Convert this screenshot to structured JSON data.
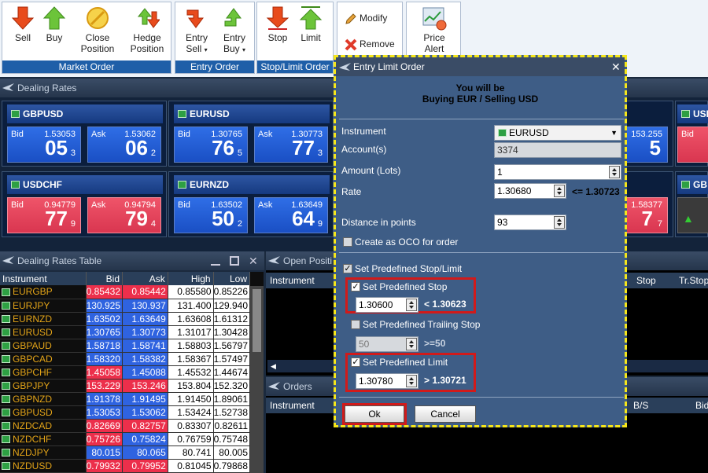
{
  "ribbon": {
    "market_order": {
      "label": "Market Order",
      "sell": "Sell",
      "buy": "Buy",
      "close1": "Close",
      "close2": "Position",
      "hedge1": "Hedge",
      "hedge2": "Position"
    },
    "entry_order": {
      "label": "Entry Order",
      "sell1": "Entry",
      "sell2": "Sell",
      "buy1": "Entry",
      "buy2": "Buy"
    },
    "stop_limit": {
      "label": "Stop/Limit Order",
      "stop": "Stop",
      "limit": "Limit"
    },
    "modify": "Modify",
    "remove": "Remove",
    "price_alert1": "Price",
    "price_alert2": "Alert"
  },
  "dealing_rates": {
    "title": "Dealing Rates",
    "tiles": [
      {
        "symbol": "GBPUSD",
        "bid_label": "Bid",
        "bid_price": "1.53053",
        "bid_big": "05",
        "bid_small": "3",
        "ask_label": "Ask",
        "ask_price": "1.53062",
        "ask_big": "06",
        "ask_small": "2"
      },
      {
        "symbol": "EURUSD",
        "bid_label": "Bid",
        "bid_price": "1.30765",
        "bid_big": "76",
        "bid_small": "5",
        "ask_label": "Ask",
        "ask_price": "1.30773",
        "ask_big": "77",
        "ask_small": "3"
      },
      {
        "symbol": "USDCHF",
        "bid_label": "Bid",
        "bid_price": "0.94779",
        "bid_big": "77",
        "bid_small": "9",
        "ask_label": "Ask",
        "ask_price": "0.94794",
        "ask_big": "79",
        "ask_small": "4"
      },
      {
        "symbol": "EURNZD",
        "bid_label": "Bid",
        "bid_price": "1.63502",
        "bid_big": "50",
        "bid_small": "2",
        "ask_label": "Ask",
        "ask_price": "1.63649",
        "ask_big": "64",
        "ask_small": "9"
      }
    ],
    "partial": {
      "top_price": "153.255",
      "top_big": "5",
      "mid_price": "1.58377",
      "mid_big": "7",
      "mid_small": "7",
      "r1": "USI",
      "r2": "GB",
      "r1_bid": "Bid"
    }
  },
  "rates_table": {
    "title": "Dealing Rates Table",
    "columns": [
      "Instrument",
      "Bid",
      "Ask",
      "High",
      "Low"
    ],
    "rows": [
      [
        "EURGBP",
        "0.85432",
        "0.85442",
        "0.85580",
        "0.85226"
      ],
      [
        "EURJPY",
        "130.925",
        "130.937",
        "131.400",
        "129.940"
      ],
      [
        "EURNZD",
        "1.63502",
        "1.63649",
        "1.63608",
        "1.61312"
      ],
      [
        "EURUSD",
        "1.30765",
        "1.30773",
        "1.31017",
        "1.30428"
      ],
      [
        "GBPAUD",
        "1.58718",
        "1.58741",
        "1.58803",
        "1.56797"
      ],
      [
        "GBPCAD",
        "1.58320",
        "1.58382",
        "1.58367",
        "1.57497"
      ],
      [
        "GBPCHF",
        "1.45058",
        "1.45088",
        "1.45532",
        "1.44674"
      ],
      [
        "GBPJPY",
        "153.229",
        "153.246",
        "153.804",
        "152.320"
      ],
      [
        "GBPNZD",
        "1.91378",
        "1.91495",
        "1.91450",
        "1.89061"
      ],
      [
        "GBPUSD",
        "1.53053",
        "1.53062",
        "1.53424",
        "1.52738"
      ],
      [
        "NZDCAD",
        "0.82669",
        "0.82757",
        "0.83307",
        "0.82611"
      ],
      [
        "NZDCHF",
        "0.75726",
        "0.75824",
        "0.76759",
        "0.75748"
      ],
      [
        "NZDJPY",
        "80.015",
        "80.065",
        "80.741",
        "80.005"
      ],
      [
        "NZDUSD",
        "0.79932",
        "0.79952",
        "0.81045",
        "0.79868"
      ]
    ],
    "bid_colors": [
      "red",
      "blue",
      "blue",
      "blue",
      "blue",
      "blue",
      "red",
      "red",
      "blue",
      "blue",
      "red",
      "red",
      "blue",
      "red"
    ],
    "ask_colors": [
      "red",
      "blue",
      "blue",
      "blue",
      "blue",
      "blue",
      "blue",
      "red",
      "blue",
      "blue",
      "red",
      "blue",
      "blue",
      "red"
    ]
  },
  "open_positions": {
    "title": "Open Positi",
    "col_instrument": "Instrument",
    "col_stop": "Stop",
    "col_trstop": "Tr.Stop"
  },
  "orders": {
    "title": "Orders",
    "col_instrument": "Instrument",
    "col_bs": "B/S",
    "col_bid": "Bid"
  },
  "dialog": {
    "title": "Entry Limit Order",
    "heading1": "You will be",
    "heading2": "Buying EUR / Selling USD",
    "instrument_label": "Instrument",
    "instrument_value": "EURUSD",
    "accounts_label": "Account(s)",
    "accounts_value": "3374",
    "amount_label": "Amount (Lots)",
    "amount_value": "1",
    "rate_label": "Rate",
    "rate_value": "1.30680",
    "rate_hint": "<= 1.30723",
    "distance_label": "Distance in points",
    "distance_value": "93",
    "oco_label": "Create as OCO for order",
    "predef_label": "Set Predefined Stop/Limit",
    "stop_label": "Set Predefined Stop",
    "stop_value": "1.30600",
    "stop_hint": "< 1.30623",
    "trailing_label": "Set Predefined Trailing Stop",
    "trailing_value": "50",
    "trailing_hint": ">=50",
    "limit_label": "Set Predefined Limit",
    "limit_value": "1.30780",
    "limit_hint": "> 1.30721",
    "ok": "Ok",
    "cancel": "Cancel"
  }
}
